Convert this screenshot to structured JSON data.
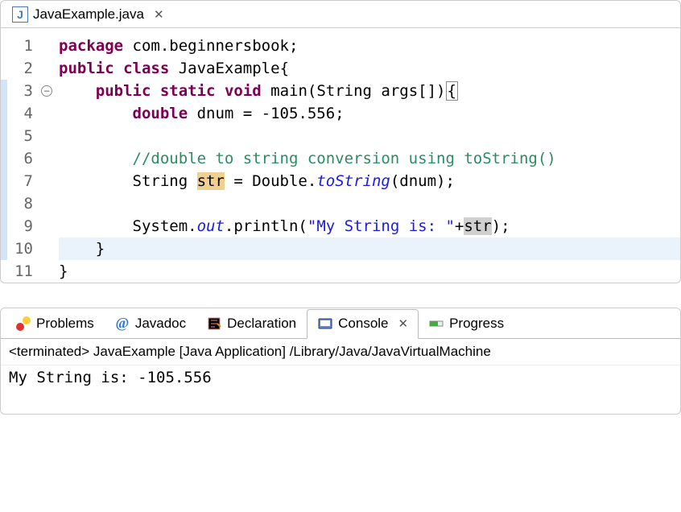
{
  "editor": {
    "tab_label": "JavaExample.java",
    "lines": {
      "l1_package": "package",
      "l1_pkgname": " com.beginnersbook;",
      "l2_public": "public",
      "l2_class": "class",
      "l2_name": " JavaExample{",
      "l3_indent": "    ",
      "l3_public": "public",
      "l3_static": "static",
      "l3_void": "void",
      "l3_sig": " main(String args[])",
      "l3_brace": "{",
      "l4_indent": "        ",
      "l4_double": "double",
      "l4_rest": " dnum = -105.556;",
      "l6_indent": "        ",
      "l6_comment": "//double to string conversion using toString()",
      "l7_indent": "        ",
      "l7_a": "String ",
      "l7_var": "str",
      "l7_b": " = Double.",
      "l7_m": "toString",
      "l7_c": "(dnum);",
      "l9_indent": "        ",
      "l9_a": "System.",
      "l9_out": "out",
      "l9_b": ".println(",
      "l9_str": "\"My String is: \"",
      "l9_c": "+",
      "l9_var": "str",
      "l9_d": ");",
      "l10": "    }",
      "l11": "}"
    },
    "line_numbers": [
      "1",
      "2",
      "3",
      "4",
      "5",
      "6",
      "7",
      "8",
      "9",
      "10",
      "11"
    ]
  },
  "bottom": {
    "tabs": {
      "problems": "Problems",
      "javadoc": "Javadoc",
      "declaration": "Declaration",
      "console": "Console",
      "progress": "Progress"
    },
    "console_header": "<terminated> JavaExample [Java Application] /Library/Java/JavaVirtualMachine",
    "console_output": "My String is: -105.556"
  }
}
